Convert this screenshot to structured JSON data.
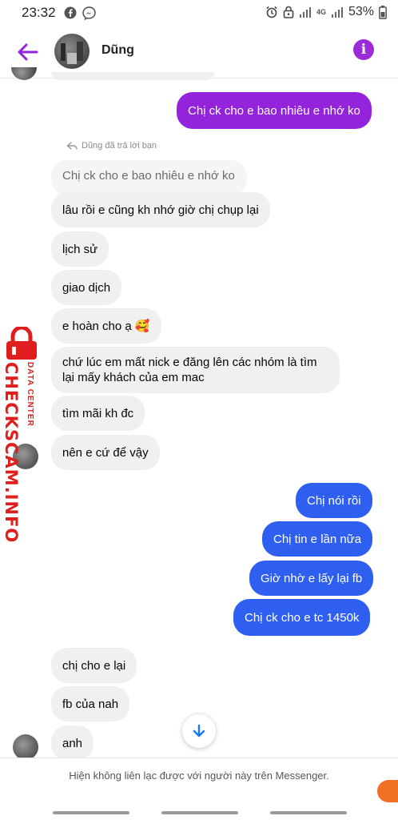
{
  "status_bar": {
    "time": "23:32",
    "network": "4G",
    "battery": "53%"
  },
  "header": {
    "contact_name": "Dũng",
    "info_symbol": "i"
  },
  "replied_note": "Dũng đã trả lời bạn",
  "messages": [
    {
      "side": "out",
      "text": "Chị ck cho e bao nhiêu e nhớ ko"
    },
    {
      "side": "quoted",
      "text": "Chị ck cho e bao nhiêu e nhớ ko"
    },
    {
      "side": "in",
      "text": "lâu rồi e cũng kh nhớ giờ chị chụp lại"
    },
    {
      "side": "in",
      "text": "lịch sử"
    },
    {
      "side": "in",
      "text": "giao dịch"
    },
    {
      "side": "in",
      "text": "e hoàn cho ạ 🥰"
    },
    {
      "side": "in",
      "text": "chứ lúc em mất nick e đăng lên các nhóm là tìm lại mấy khách của em mac"
    },
    {
      "side": "in",
      "text": "tìm mãi kh đc"
    },
    {
      "side": "in",
      "text": "nên e cứ để vậy"
    },
    {
      "side": "out",
      "text": "Chị nói rồi"
    },
    {
      "side": "out",
      "text": "Chị tin e lần nữa"
    },
    {
      "side": "out",
      "text": "Giờ nhờ e lấy lại fb"
    },
    {
      "side": "out",
      "text": "Chị ck cho e tc 1450k"
    },
    {
      "side": "in",
      "text": "chị cho e lại"
    },
    {
      "side": "in",
      "text": "fb của nah"
    },
    {
      "side": "in",
      "text": "anh"
    }
  ],
  "watermark": {
    "main": "CHECKSCAM.INFO",
    "sub": "DATA CENTER"
  },
  "footer": {
    "notice": "Hiện không liên lạc được với người này trên Messenger."
  },
  "colors": {
    "accent_purple": "#9423dc",
    "accent_blue": "#2e5ff1",
    "incoming_bg": "#f0f0f0",
    "watermark_red": "#e01e1e"
  },
  "icons": [
    "facebook-icon",
    "messenger-icon",
    "alarm-icon",
    "lock-icon",
    "signal-icon",
    "back-arrow-icon",
    "info-icon",
    "reply-icon",
    "arrow-down-icon"
  ]
}
